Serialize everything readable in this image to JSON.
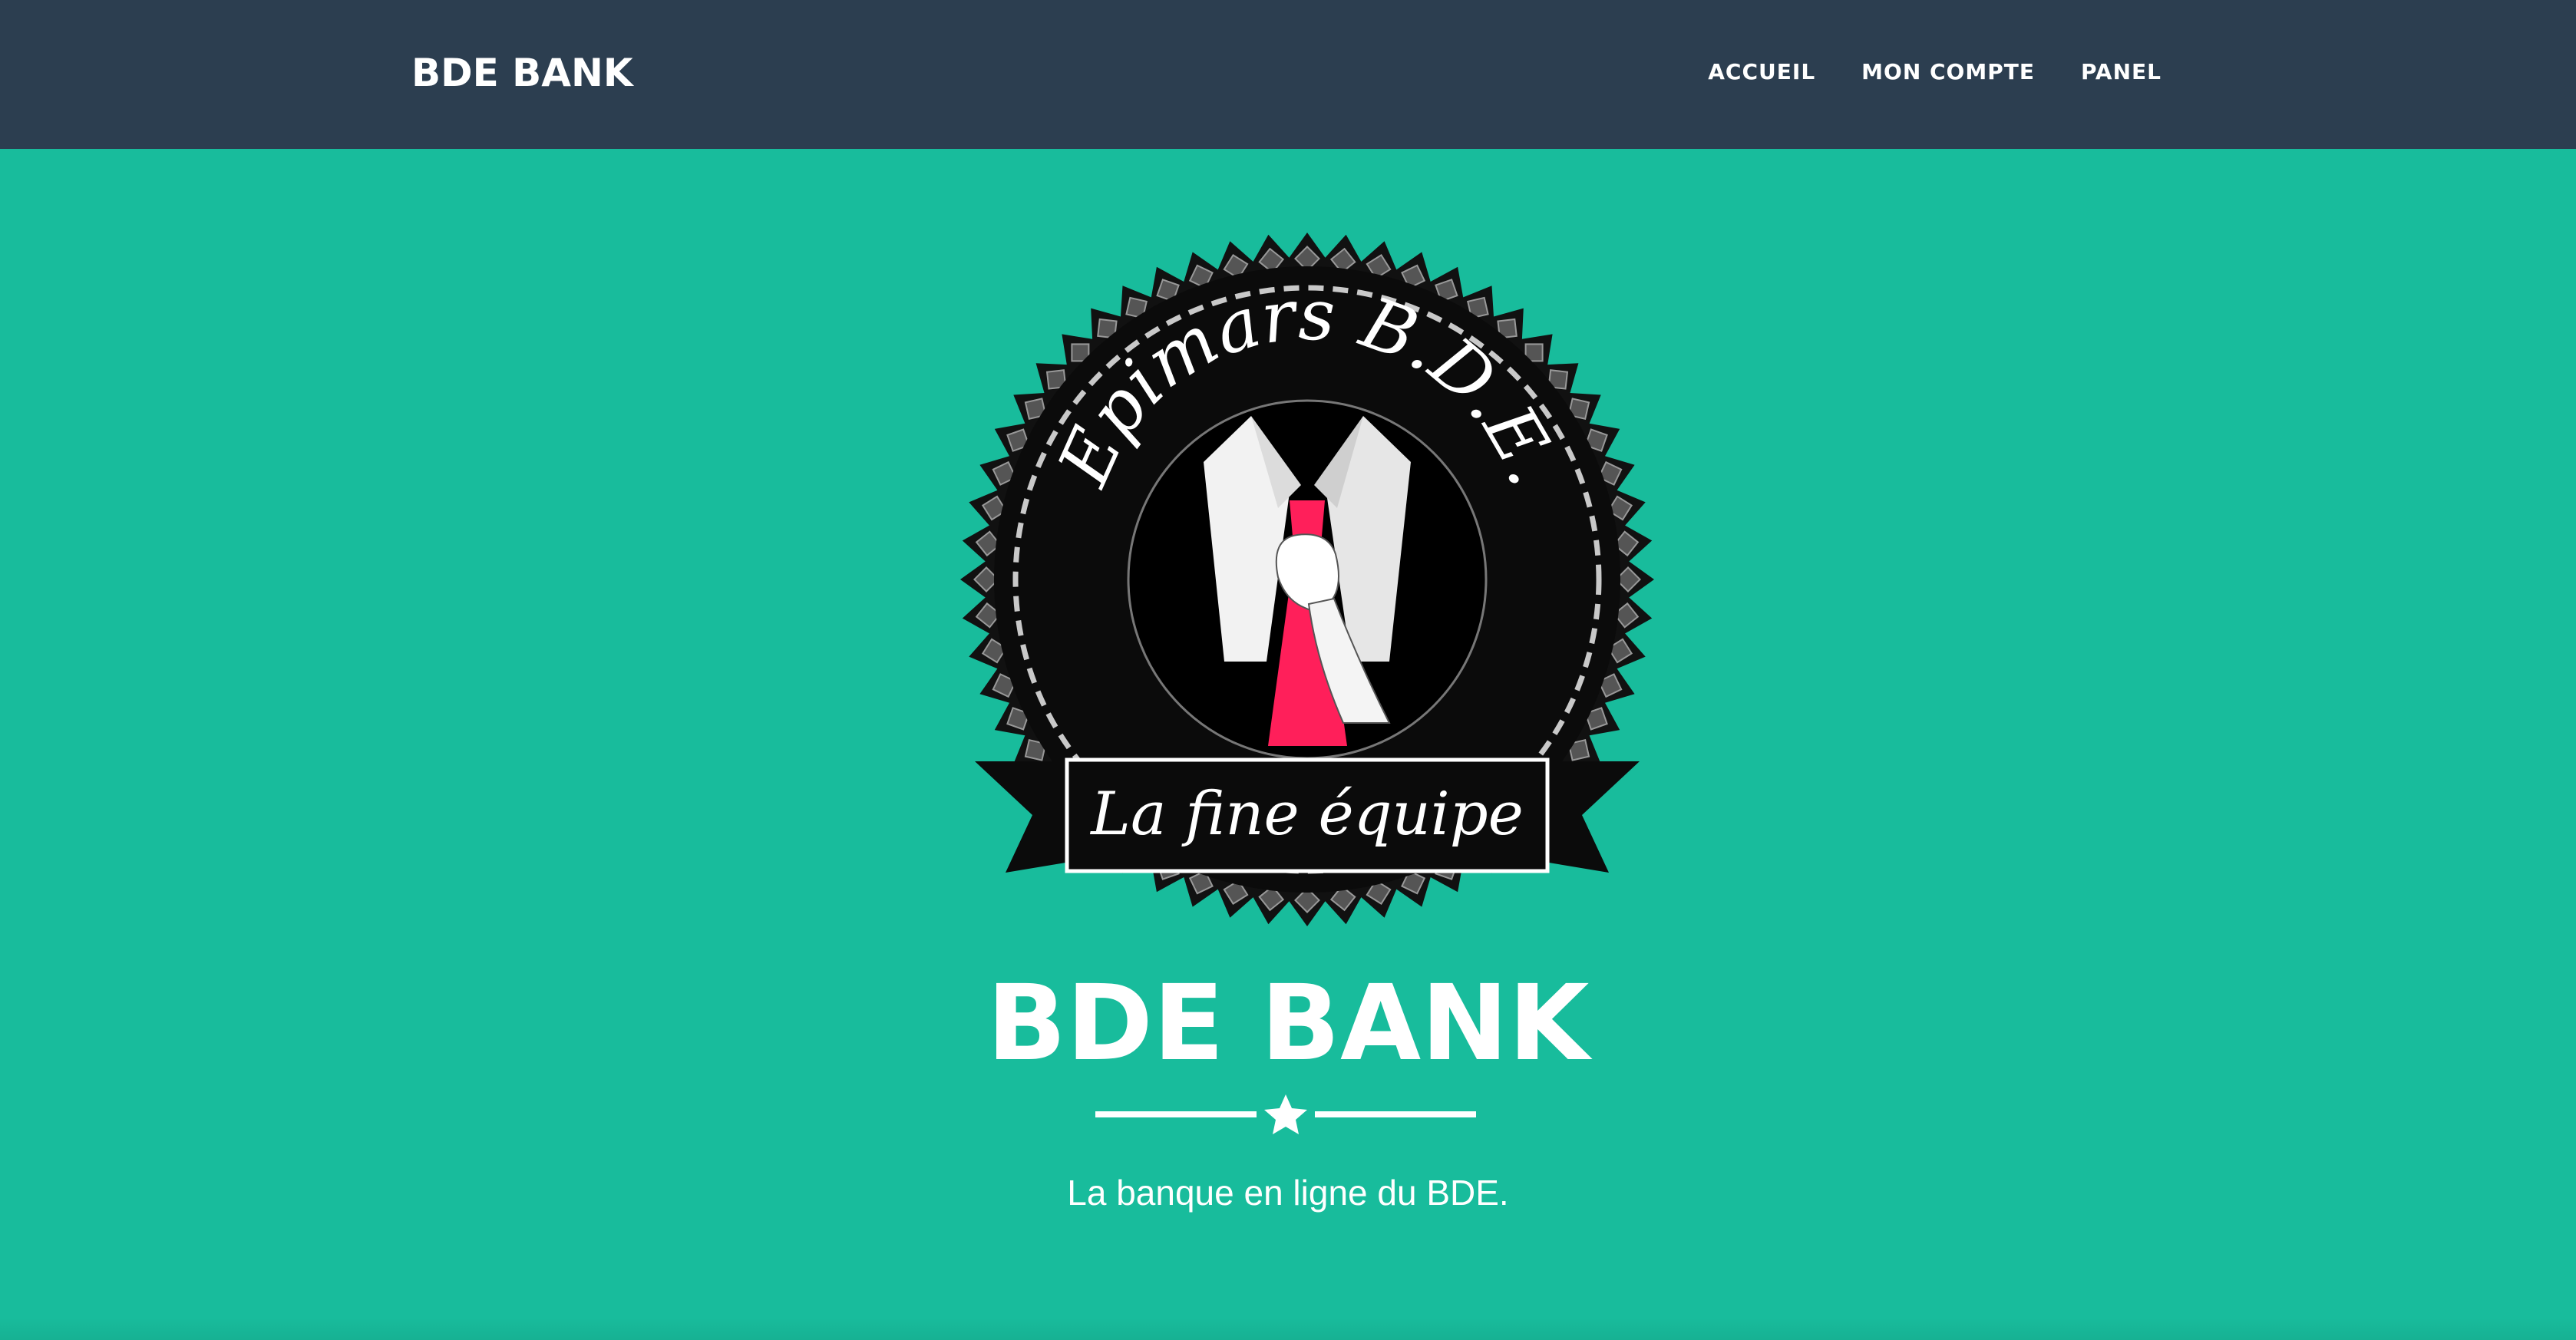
{
  "navbar": {
    "brand": "BDE BANK",
    "links": [
      {
        "label": "ACCUEIL"
      },
      {
        "label": "MON COMPTE"
      },
      {
        "label": "PANEL"
      }
    ]
  },
  "hero": {
    "logo": {
      "top_text": "Epimars B.D.E.",
      "ribbon_text": "La fine équipe"
    },
    "title": "BDE BANK",
    "divider_icon": "star-icon",
    "tagline": "La banque en ligne du BDE."
  },
  "colors": {
    "navbar_bg": "#2c3e50",
    "hero_bg": "#18bc9c",
    "text": "#ffffff",
    "tie": "#ff1f5a"
  }
}
